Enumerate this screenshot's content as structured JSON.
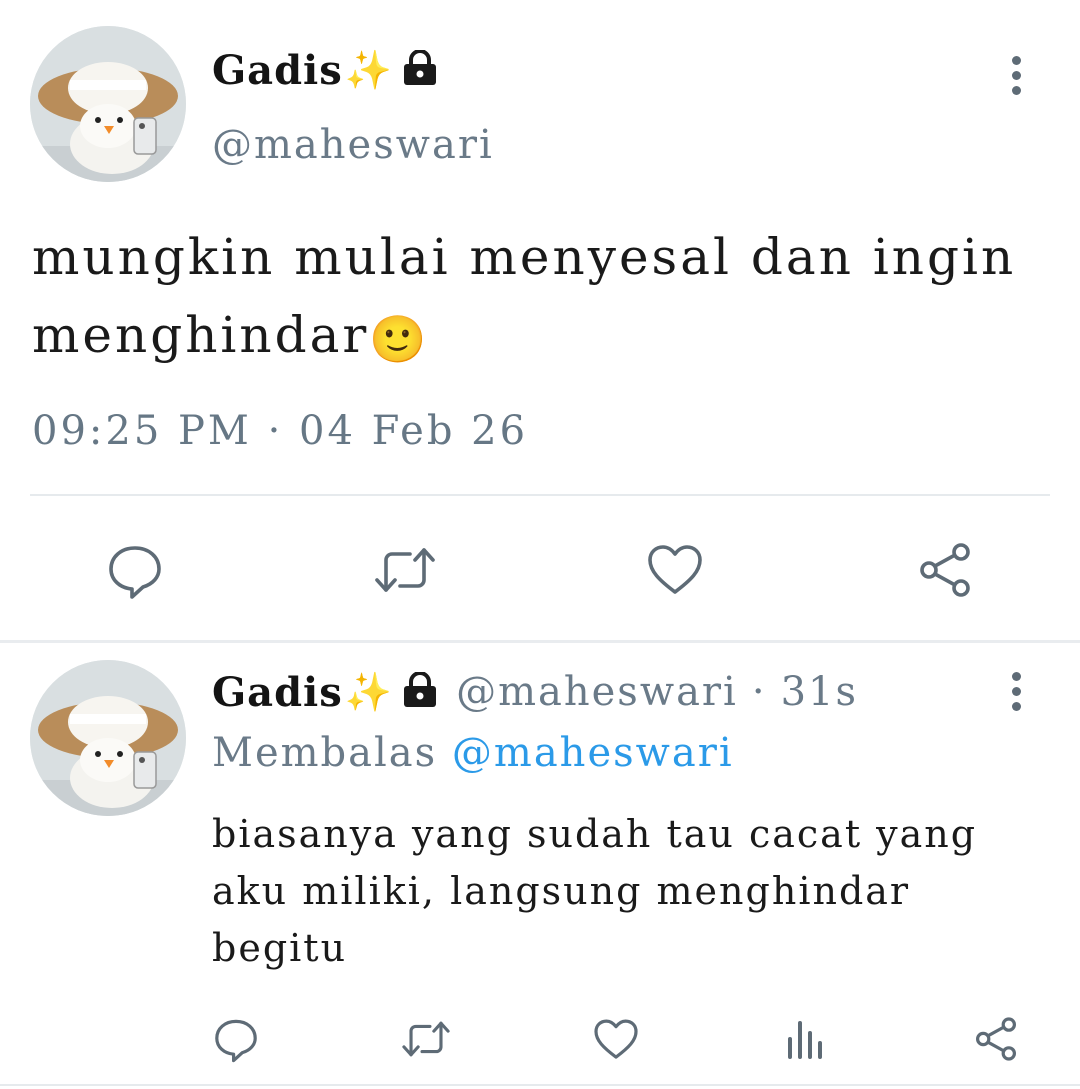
{
  "tweet": {
    "display_name": "Gadis",
    "sparkle_emoji": "✨",
    "handle": "@maheswari",
    "text": "mungkin mulai menyesal dan ingin menghindar",
    "text_emoji": "🙂",
    "timestamp": "09:25 PM · 04 Feb 26"
  },
  "reply": {
    "display_name": "Gadis",
    "sparkle_emoji": "✨",
    "handle": "@maheswari",
    "separator": "·",
    "age": "31s",
    "replying_prefix": "Membalas",
    "replying_to": "@maheswari",
    "text": "biasanya yang sudah tau cacat yang aku miliki, langsung menghindar begitu"
  },
  "icons": {
    "reply": "comment-icon",
    "retweet": "retweet-icon",
    "like": "heart-icon",
    "share": "share-icon",
    "views": "bar-chart-icon",
    "more": "more-vertical-icon",
    "protected": "lock-icon"
  },
  "colors": {
    "mention": "#2b9ae8",
    "muted": "#6a7a88",
    "icon": "#5e6b76"
  }
}
